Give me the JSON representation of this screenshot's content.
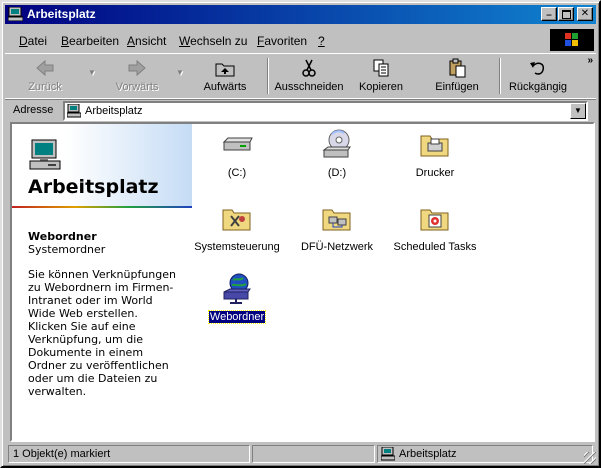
{
  "window": {
    "title": "Arbeitsplatz"
  },
  "menu": [
    {
      "pre": "",
      "u": "D",
      "post": "atei"
    },
    {
      "pre": "",
      "u": "B",
      "post": "earbeiten"
    },
    {
      "pre": "",
      "u": "A",
      "post": "nsicht"
    },
    {
      "pre": "",
      "u": "W",
      "post": "echseln zu"
    },
    {
      "pre": "",
      "u": "F",
      "post": "avoriten"
    },
    {
      "pre": "",
      "u": "?",
      "post": ""
    }
  ],
  "toolbar": {
    "back": "Zurück",
    "forward": "Vorwärts",
    "up": "Aufwärts",
    "cut": "Ausschneiden",
    "copy": "Kopieren",
    "paste": "Einfügen",
    "undo": "Rückgängig",
    "more": "»"
  },
  "address": {
    "label": "Adresse",
    "value": "Arbeitsplatz"
  },
  "leftpane": {
    "title": "Arbeitsplatz",
    "selected_name": "Webordner",
    "selected_type": "Systemordner",
    "description": "Sie können Verknüpfungen zu Webordnern im Firmen-Intranet oder im World Wide Web erstellen. Klicken Sie auf eine Verknüpfung, um die Dokumente in einem Ordner zu veröffentlichen oder um die Dateien zu verwalten."
  },
  "items": [
    {
      "label": "(C:)",
      "icon": "hard-drive-icon"
    },
    {
      "label": "(D:)",
      "icon": "cd-drive-icon"
    },
    {
      "label": "Drucker",
      "icon": "printer-folder-icon"
    },
    {
      "label": "Systemsteuerung",
      "icon": "control-panel-folder-icon"
    },
    {
      "label": "DFÜ-Netzwerk",
      "icon": "dialup-network-folder-icon"
    },
    {
      "label": "Scheduled Tasks",
      "icon": "scheduled-tasks-folder-icon"
    },
    {
      "label": "Webordner",
      "icon": "web-folder-icon"
    }
  ],
  "status": {
    "left": "1 Objekt(e) markiert",
    "middle": "",
    "right": "Arbeitsplatz"
  },
  "colors": {
    "titlebar_start": "#000080",
    "titlebar_end": "#1084d0",
    "face": "#c0c0c0",
    "desktop": "#008080",
    "selection": "#000080"
  }
}
